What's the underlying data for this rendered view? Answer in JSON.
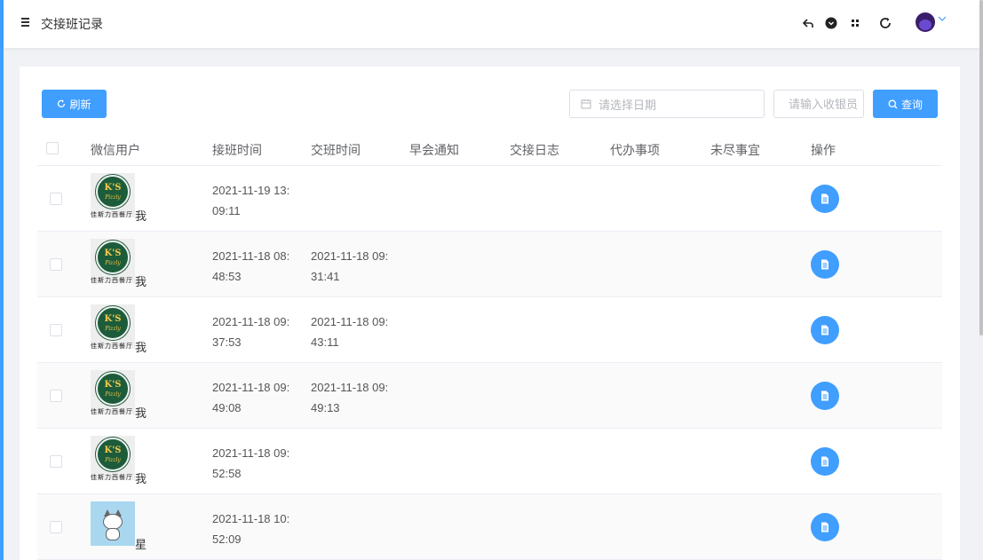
{
  "header": {
    "title": "交接班记录",
    "icons": [
      "menu-icon",
      "back-icon",
      "github-icon",
      "apps-icon",
      "refresh-icon",
      "avatar",
      "chevron-down-icon"
    ]
  },
  "toolbar": {
    "refresh_label": "刷新",
    "date_placeholder": "请选择日期",
    "text_placeholder": "请输入收银员",
    "search_label": "查询"
  },
  "table": {
    "columns": [
      "微信用户",
      "接班时间",
      "交班时间",
      "早会通知",
      "交接日志",
      "代办事项",
      "未尽事宜",
      "操作"
    ],
    "rows": [
      {
        "avatar": "ks",
        "avatar_caption": "佳斯力西餐厅",
        "user": "我",
        "start_time": "2021-11-19 13:09:11",
        "end_time": ""
      },
      {
        "avatar": "ks",
        "avatar_caption": "佳斯力西餐厅",
        "user": "我",
        "start_time": "2021-11-18 08:48:53",
        "end_time": "2021-11-18 09:31:41"
      },
      {
        "avatar": "ks",
        "avatar_caption": "佳斯力西餐厅",
        "user": "我",
        "start_time": "2021-11-18 09:37:53",
        "end_time": "2021-11-18 09:43:11"
      },
      {
        "avatar": "ks",
        "avatar_caption": "佳斯力西餐厅",
        "user": "我",
        "start_time": "2021-11-18 09:49:08",
        "end_time": "2021-11-18 09:49:13"
      },
      {
        "avatar": "ks",
        "avatar_caption": "佳斯力西餐厅",
        "user": "我",
        "start_time": "2021-11-18 09:52:58",
        "end_time": ""
      },
      {
        "avatar": "cat",
        "avatar_caption": "",
        "user": "星",
        "start_time": "2021-11-18 10:52:09",
        "end_time": ""
      }
    ]
  },
  "logo": {
    "ks_text": "K'S",
    "ks_sub": "Pizzly"
  },
  "colors": {
    "primary": "#409eff",
    "border": "#ebeef5",
    "stripe": "#fafafa"
  }
}
